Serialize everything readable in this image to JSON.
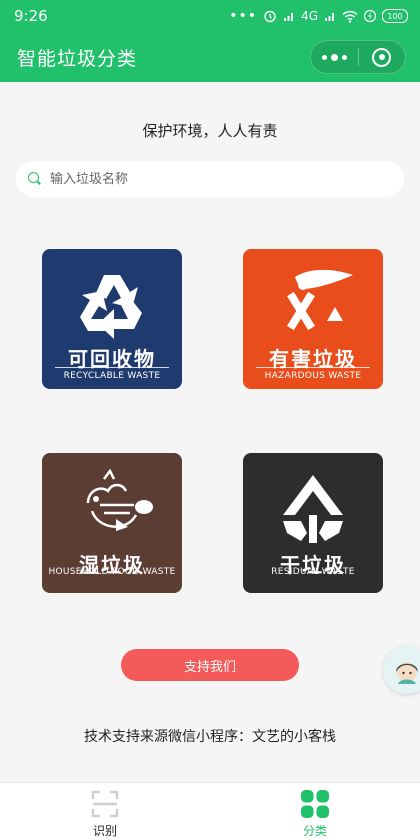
{
  "status_bar": {
    "time": "9:26",
    "network": "4G",
    "battery": "100"
  },
  "header": {
    "title": "智能垃圾分类"
  },
  "main": {
    "slogan": "保护环境，人人有责",
    "search": {
      "placeholder": "输入垃圾名称",
      "value": ""
    },
    "categories": [
      {
        "cn": "可回收物",
        "en": "RECYCLABLE WASTE",
        "color": "#1f3a6f",
        "icon": "recycle-icon"
      },
      {
        "cn": "有害垃圾",
        "en": "HAZARDOUS WASTE",
        "color": "#e84d1b",
        "icon": "hazard-icon"
      },
      {
        "cn": "湿垃圾",
        "en": "HOUSEHOLD FOOD WASTE",
        "color": "#5b3d34",
        "icon": "food-waste-icon"
      },
      {
        "cn": "干垃圾",
        "en": "RESIDUAL WASTE",
        "color": "#2e2c2d",
        "icon": "residual-waste-icon"
      }
    ],
    "support_label": "支持我们",
    "credit": "技术支持来源微信小程序：文艺的小客栈"
  },
  "tabbar": {
    "tabs": [
      {
        "label": "识别",
        "icon": "scan-icon",
        "active": false
      },
      {
        "label": "分类",
        "icon": "grid-icon",
        "active": true
      }
    ]
  },
  "colors": {
    "brand": "#21c16b",
    "support_button": "#f45a5a"
  }
}
